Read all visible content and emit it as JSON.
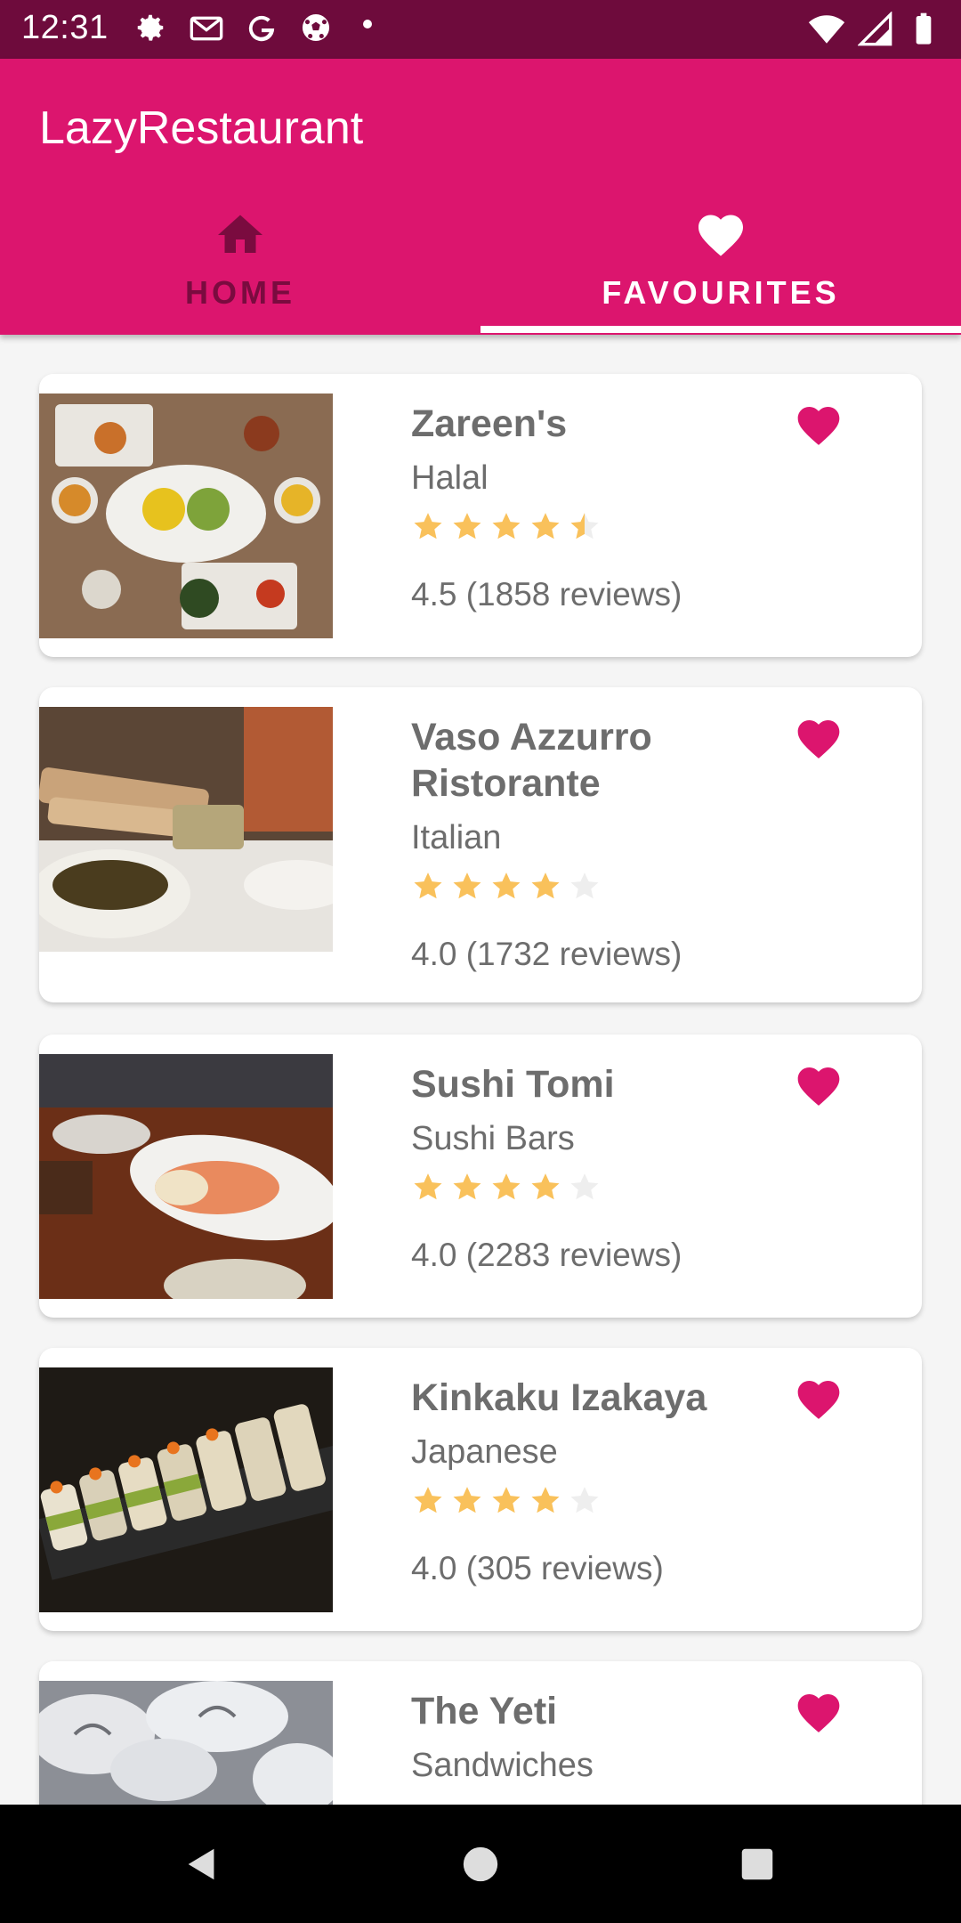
{
  "status_bar": {
    "time": "12:31",
    "icons": [
      "settings-icon",
      "gmail-icon",
      "google-icon",
      "soccer-icon",
      "dot-icon",
      "wifi-icon",
      "signal-icon",
      "battery-icon"
    ]
  },
  "app": {
    "title": "LazyRestaurant",
    "accent": "#dc156e",
    "statusbar_color": "#6e0b3c"
  },
  "tabs": [
    {
      "label": "HOME",
      "icon": "home-icon",
      "selected": false
    },
    {
      "label": "FAVOURITES",
      "icon": "heart-icon",
      "selected": true
    }
  ],
  "restaurants": [
    {
      "name": "Zareen's",
      "cuisine": "Halal",
      "rating": 4.5,
      "reviews": "4.5 (1858 reviews)",
      "favourite": true
    },
    {
      "name": "Vaso Azzurro Ristorante",
      "cuisine": "Italian",
      "rating": 4.0,
      "reviews": "4.0 (1732 reviews)",
      "favourite": true
    },
    {
      "name": "Sushi Tomi",
      "cuisine": "Sushi Bars",
      "rating": 4.0,
      "reviews": "4.0 (2283 reviews)",
      "favourite": true
    },
    {
      "name": "Kinkaku Izakaya",
      "cuisine": "Japanese",
      "rating": 4.0,
      "reviews": "4.0 (305 reviews)",
      "favourite": true
    },
    {
      "name": "The Yeti",
      "cuisine": "Sandwiches",
      "rating": null,
      "reviews": null,
      "favourite": true
    }
  ],
  "nav_bar": [
    "back-icon",
    "home-circle-icon",
    "recents-icon"
  ]
}
